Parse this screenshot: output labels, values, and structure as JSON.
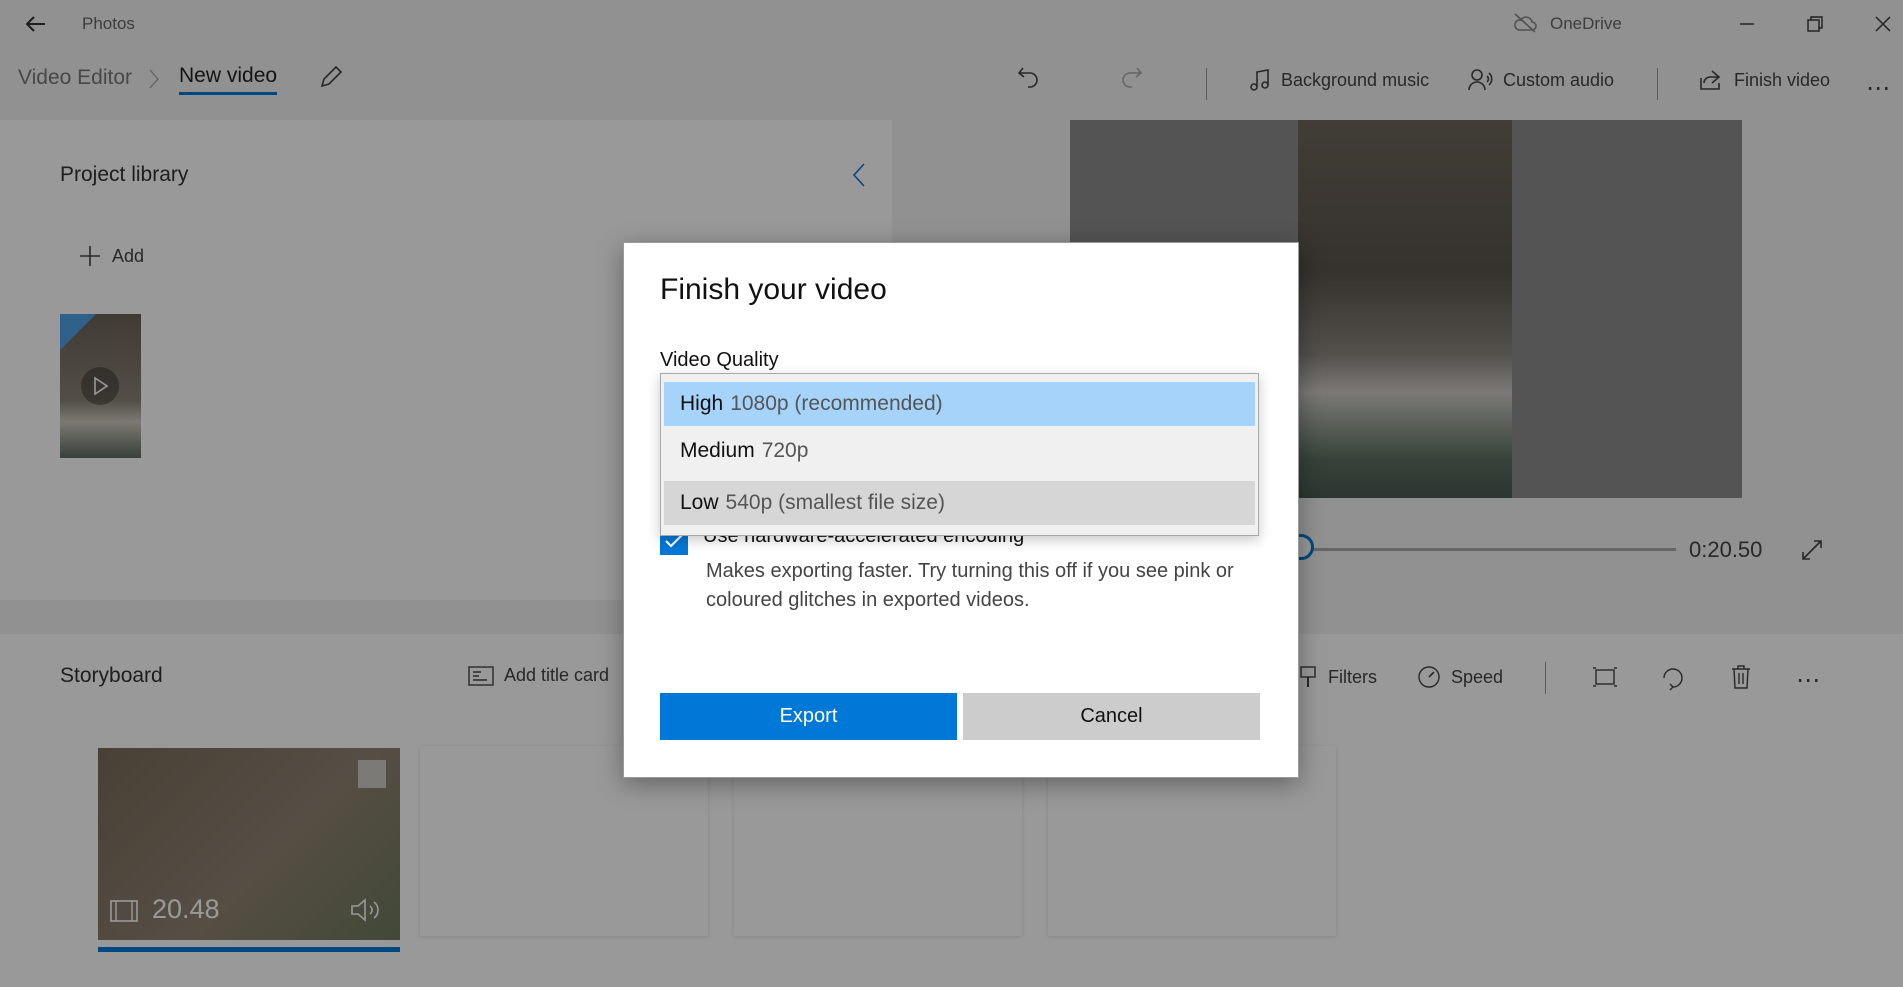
{
  "app": {
    "title": "Photos",
    "onedrive_label": "OneDrive"
  },
  "toolbar": {
    "breadcrumb_parent": "Video Editor",
    "breadcrumb_current": "New video",
    "background_music": "Background music",
    "custom_audio": "Custom audio",
    "finish_video": "Finish video"
  },
  "library": {
    "title": "Project library",
    "add_label": "Add"
  },
  "preview": {
    "time": "0:20.50"
  },
  "storyboard": {
    "title": "Storyboard",
    "add_title_card": "Add title card",
    "filters": "Filters",
    "speed": "Speed",
    "clip_duration": "20.48"
  },
  "dialog": {
    "title": "Finish your video",
    "quality_label": "Video Quality",
    "options": [
      {
        "name": "High",
        "detail": "1080p (recommended)"
      },
      {
        "name": "Medium",
        "detail": "720p"
      },
      {
        "name": "Low",
        "detail": "540p (smallest file size)"
      }
    ],
    "hw_label": "Use hardware-accelerated encoding",
    "hw_desc": "Makes exporting faster. Try turning this off if you see pink or coloured glitches in exported videos.",
    "export_label": "Export",
    "cancel_label": "Cancel"
  },
  "colors": {
    "accent": "#0078d7",
    "selected_option": "#a6d3f9",
    "hover_option": "#d6d6d6"
  }
}
